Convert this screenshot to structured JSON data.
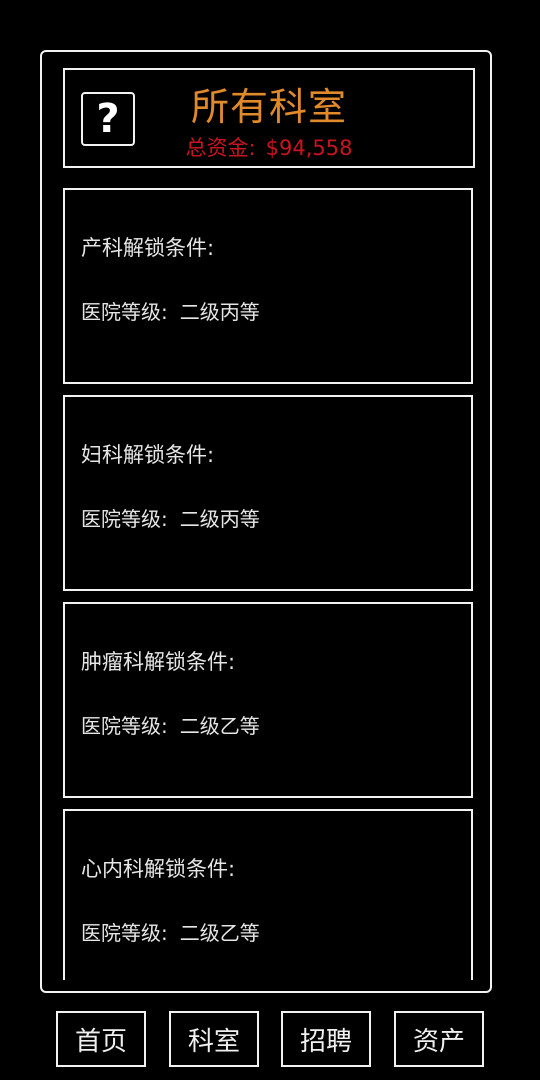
{
  "header": {
    "help_icon": "?",
    "title": "所有科室",
    "funds_label": "总资金:",
    "funds_value": "$94,558"
  },
  "departments": [
    {
      "name": "产科解锁条件:",
      "requirement_label": "医院等级:",
      "requirement_value": "二级丙等"
    },
    {
      "name": "妇科解锁条件:",
      "requirement_label": "医院等级:",
      "requirement_value": "二级丙等"
    },
    {
      "name": "肿瘤科解锁条件:",
      "requirement_label": "医院等级:",
      "requirement_value": "二级乙等"
    },
    {
      "name": "心内科解锁条件:",
      "requirement_label": "医院等级:",
      "requirement_value": "二级乙等"
    }
  ],
  "nav": {
    "home": "首页",
    "departments": "科室",
    "recruit": "招聘",
    "assets": "资产"
  },
  "colors": {
    "background": "#000000",
    "title": "#e08a2c",
    "funds": "#c8141e",
    "border": "#f2f2f2"
  }
}
